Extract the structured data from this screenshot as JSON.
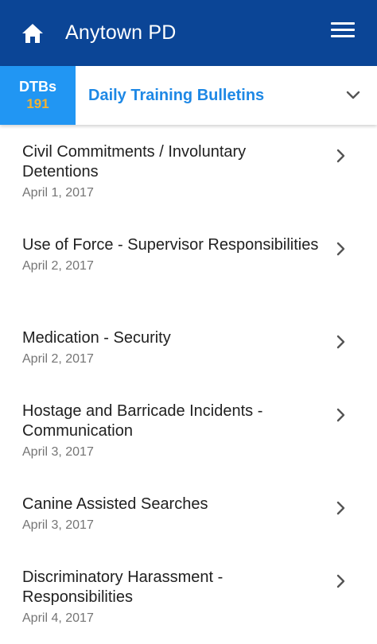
{
  "header": {
    "title": "Anytown PD",
    "home_icon": "home-icon",
    "menu_icon": "hamburger-menu-icon",
    "background_color": "#0b4596"
  },
  "section": {
    "badge_label": "DTBs",
    "badge_count": "191",
    "title": "Daily Training Bulletins",
    "badge_color": "#2196f3",
    "count_color": "#f2b233",
    "title_color": "#1e88e5"
  },
  "bulletins": [
    {
      "title": "Civil Commitments / Involuntary Detentions",
      "date": "April 1, 2017"
    },
    {
      "title": "Use of Force - Supervisor Responsibilities",
      "date": "April 2, 2017"
    },
    {
      "title": "Medication - Security",
      "date": "April 2, 2017"
    },
    {
      "title": "Hostage and Barricade Incidents - Communication",
      "date": "April 3, 2017"
    },
    {
      "title": "Canine Assisted Searches",
      "date": "April 3, 2017"
    },
    {
      "title": "Discriminatory Harassment - Responsibilities",
      "date": "April 4, 2017"
    }
  ]
}
